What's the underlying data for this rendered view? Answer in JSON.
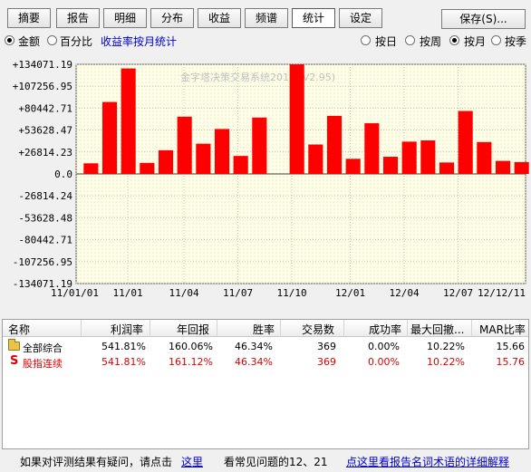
{
  "tabs": [
    {
      "label": "摘要",
      "active": false
    },
    {
      "label": "报告",
      "active": false
    },
    {
      "label": "明细",
      "active": false
    },
    {
      "label": "分布",
      "active": false
    },
    {
      "label": "收益",
      "active": false
    },
    {
      "label": "频谱",
      "active": false
    },
    {
      "label": "统计",
      "active": true
    },
    {
      "label": "设定",
      "active": false
    }
  ],
  "save_label": "保存(S)...",
  "options_left": {
    "amount_label": "金额",
    "percent_label": "百分比",
    "monthly_link": "收益率按月统计",
    "selected": "amount"
  },
  "options_right": {
    "daily_label": "按日",
    "weekly_label": "按周",
    "monthly_label": "按月",
    "quarterly_label": "按季",
    "selected": "monthly"
  },
  "chart_data": {
    "type": "bar",
    "watermark": "金字塔决策交易系统2013 (V2.95)",
    "y_ticks": [
      "+134071.19",
      "+107256.95",
      "+80442.71",
      "+53628.47",
      "+26814.23",
      "0.0",
      "-26814.24",
      "-53628.48",
      "-80442.71",
      "-107256.95",
      "-134071.19"
    ],
    "x_ticks": [
      "11/01/01",
      "11/01",
      "11/04",
      "11/07",
      "11/10",
      "12/01",
      "12/04",
      "12/07",
      "12/12/11"
    ],
    "ylim": [
      -134071.19,
      134071.19
    ],
    "bar_color": "#ff0000",
    "values": [
      13000,
      88000,
      129000,
      13500,
      29000,
      70000,
      37000,
      55000,
      22000,
      69000,
      0,
      136000,
      36000,
      71000,
      18500,
      62000,
      21000,
      39500,
      41000,
      14000,
      77000,
      39000,
      16000,
      14500
    ]
  },
  "table": {
    "headers": [
      "名称",
      "利润率",
      "年回报",
      "胜率",
      "交易数",
      "成功率",
      "最大回撤...",
      "MAR比率"
    ],
    "rows": [
      {
        "icon": "folder-icon",
        "color": "#000000",
        "cells": [
          "全部综合",
          "541.81%",
          "160.06%",
          "46.34%",
          "369",
          "0.00%",
          "10.22%",
          "15.66"
        ]
      },
      {
        "icon": "s-icon",
        "icon_text": "S",
        "color": "#e00000",
        "cells": [
          "股指连续",
          "541.81%",
          "161.12%",
          "46.34%",
          "369",
          "0.00%",
          "10.22%",
          "15.76"
        ]
      }
    ]
  },
  "footer": {
    "question_text": "如果对评测结果有疑问，请点击",
    "here_link": "这里",
    "faq_text": "看常见问题的12、21",
    "glossary_link": "点这里看报告名词术语的详细解释"
  }
}
